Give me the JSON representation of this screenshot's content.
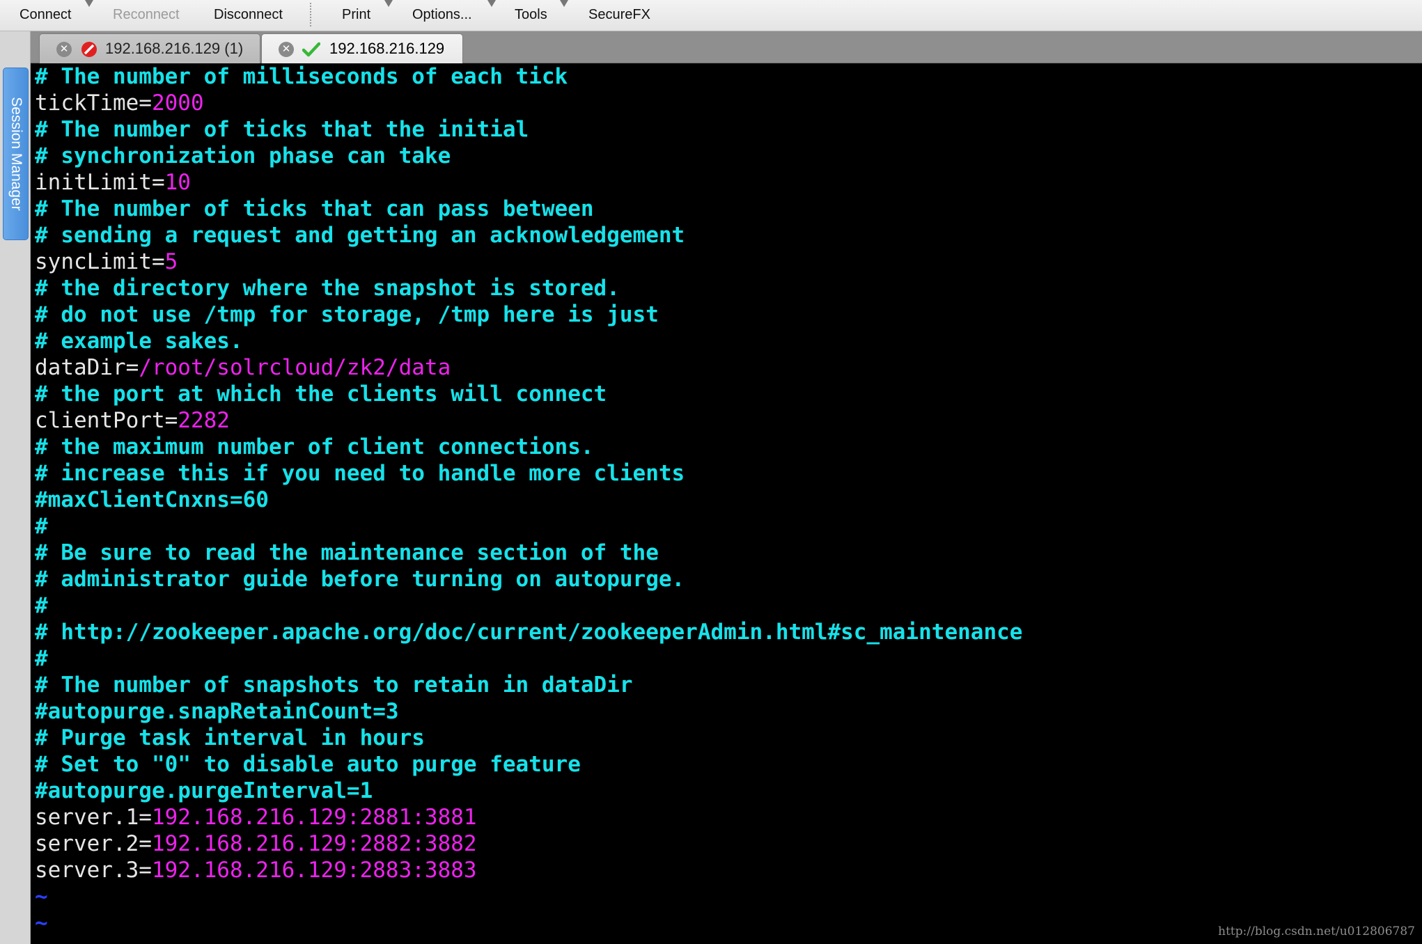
{
  "toolbar": {
    "connect": "Connect",
    "reconnect": "Reconnect",
    "disconnect": "Disconnect",
    "print": "Print",
    "options": "Options...",
    "tools": "Tools",
    "securefx": "SecureFX"
  },
  "session_manager": {
    "label": "Session Manager"
  },
  "tabs": [
    {
      "label": "192.168.216.129 (1)",
      "status": "disconnected",
      "status_icon": "no-entry-icon",
      "status_color": "#e02020"
    },
    {
      "label": "192.168.216.129",
      "status": "connected",
      "status_icon": "check-icon",
      "status_color": "#38b838"
    }
  ],
  "terminal": {
    "colors": {
      "comment": "#16e2ea",
      "key": "#e6e6e6",
      "value": "#ee22ee",
      "tilde": "#2b3fff",
      "background": "#000000"
    },
    "lines": [
      {
        "comment": "# The number of milliseconds of each tick"
      },
      {
        "key": "tickTime=",
        "value": "2000"
      },
      {
        "comment": "# The number of ticks that the initial"
      },
      {
        "comment": "# synchronization phase can take"
      },
      {
        "key": "initLimit=",
        "value": "10"
      },
      {
        "comment": "# The number of ticks that can pass between"
      },
      {
        "comment": "# sending a request and getting an acknowledgement"
      },
      {
        "key": "syncLimit=",
        "value": "5"
      },
      {
        "comment": "# the directory where the snapshot is stored."
      },
      {
        "comment": "# do not use /tmp for storage, /tmp here is just"
      },
      {
        "comment": "# example sakes."
      },
      {
        "key": "dataDir=",
        "value": "/root/solrcloud/zk2/data"
      },
      {
        "comment": "# the port at which the clients will connect"
      },
      {
        "key": "clientPort=",
        "value": "2282"
      },
      {
        "comment": "# the maximum number of client connections."
      },
      {
        "comment": "# increase this if you need to handle more clients"
      },
      {
        "comment": "#maxClientCnxns=60"
      },
      {
        "comment": "#"
      },
      {
        "comment": "# Be sure to read the maintenance section of the"
      },
      {
        "comment": "# administrator guide before turning on autopurge."
      },
      {
        "comment": "#"
      },
      {
        "comment": "# http://zookeeper.apache.org/doc/current/zookeeperAdmin.html#sc_maintenance"
      },
      {
        "comment": "#"
      },
      {
        "comment": "# The number of snapshots to retain in dataDir"
      },
      {
        "comment": "#autopurge.snapRetainCount=3"
      },
      {
        "comment": "# Purge task interval in hours"
      },
      {
        "comment": "# Set to \"0\" to disable auto purge feature"
      },
      {
        "comment": "#autopurge.purgeInterval=1"
      },
      {
        "key": "server.1=",
        "value": "192.168.216.129:2881:3881"
      },
      {
        "key": "server.2=",
        "value": "192.168.216.129:2882:3882"
      },
      {
        "key": "server.3=",
        "value": "192.168.216.129:2883:3883"
      },
      {
        "tilde": "~"
      },
      {
        "tilde": "~"
      }
    ]
  },
  "watermark": "http://blog.csdn.net/u012806787"
}
